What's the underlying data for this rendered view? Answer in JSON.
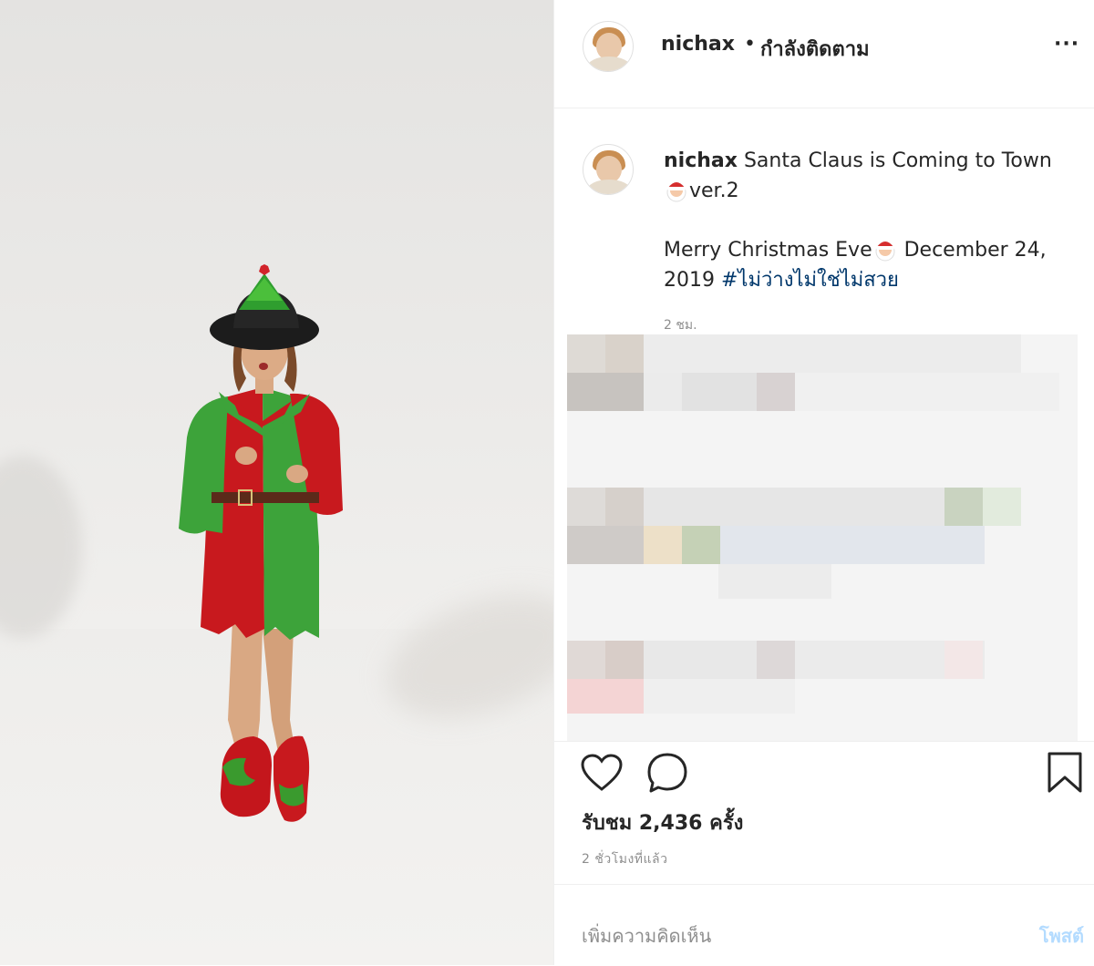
{
  "post": {
    "username": "nichax",
    "separator": "•",
    "follow_status": "กำลังติดตาม",
    "more_label": "···"
  },
  "caption": {
    "username": "nichax",
    "line1": "Santa Claus is Coming to Town",
    "line1_end": "ver.2",
    "line2_start": "Merry Christmas Eve",
    "line2_end": "December 24, 2019",
    "hashtag": "#ไม่ว่างไม่ใช่ไม่สวย",
    "time_short": "2 ชม."
  },
  "stats": {
    "views": "รับชม 2,436 ครั้ง",
    "time_ago": "2 ชั่วโมงที่แล้ว"
  },
  "comment": {
    "placeholder": "เพิ่มความคิดเห็น",
    "post_label": "โพสต์"
  },
  "icons": {
    "like": "heart-icon",
    "comment": "comment-bubble-icon",
    "save": "bookmark-icon",
    "more": "more-options-icon",
    "emoji": "santa-emoji-icon"
  },
  "colors": {
    "text": "#262626",
    "muted": "#8e8e8e",
    "link": "#00376b",
    "post_button": "#b3dbff",
    "border": "#efefef"
  }
}
